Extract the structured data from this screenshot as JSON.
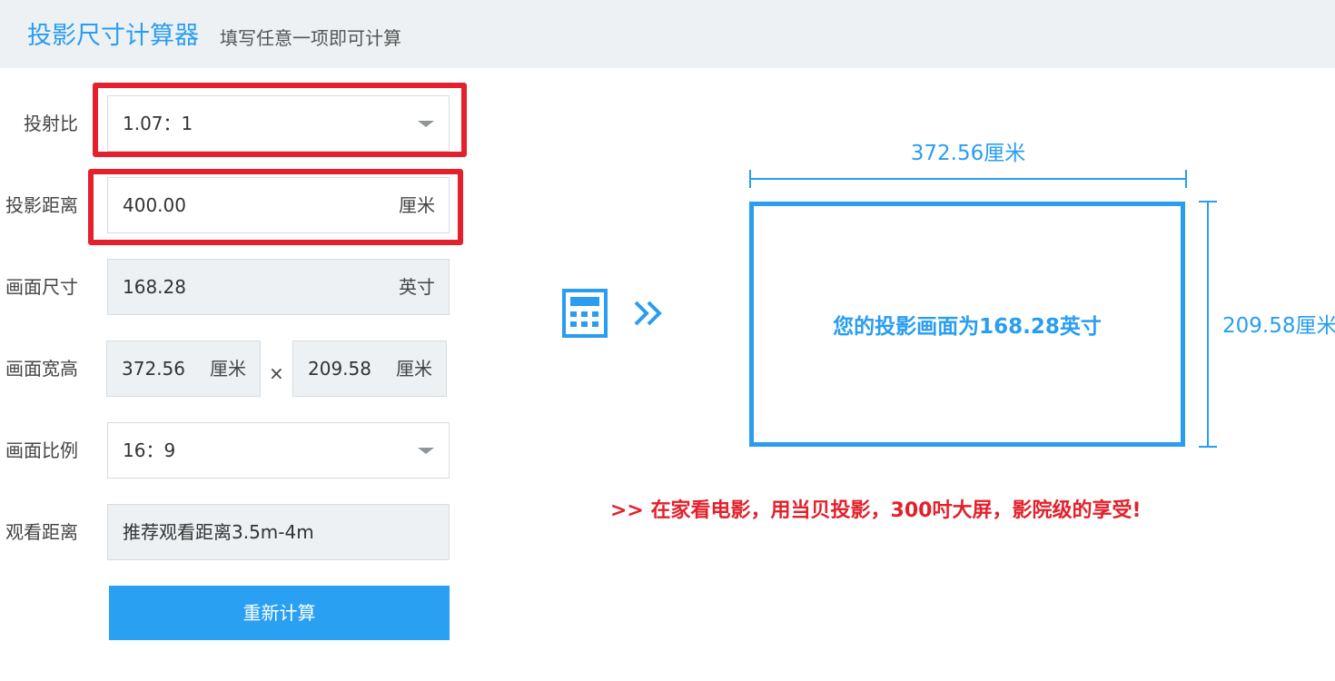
{
  "header": {
    "title": "投影尺寸计算器",
    "subtitle": "填写任意一项即可计算"
  },
  "form": {
    "throw_ratio": {
      "label": "投射比",
      "value": "1.07：1"
    },
    "projection_distance": {
      "label": "投影距离",
      "value": "400.00",
      "unit": "厘米"
    },
    "screen_size": {
      "label": "画面尺寸",
      "value": "168.28",
      "unit": "英寸"
    },
    "width_height": {
      "label": "画面宽高",
      "width": "372.56",
      "width_unit": "厘米",
      "separator": "×",
      "height": "209.58",
      "height_unit": "厘米"
    },
    "aspect_ratio": {
      "label": "画面比例",
      "value": "16：9"
    },
    "viewing_distance": {
      "label": "观看距离",
      "value": "推荐观看距离3.5m-4m"
    },
    "recalc_button": "重新计算"
  },
  "preview": {
    "width_label": "372.56厘米",
    "height_label": "209.58厘米",
    "screen_text": "您的投影画面为168.28英寸"
  },
  "promo": ">> 在家看电影，用当贝投影，300吋大屏，影院级的享受!",
  "colors": {
    "accent": "#2a9df0",
    "highlight": "#e3202b",
    "readonly_bg": "#edf1f3",
    "button_bg": "#29a0f2"
  },
  "icons": [
    "calculator-icon",
    "double-chevron-right-icon",
    "caret-down-icon"
  ]
}
